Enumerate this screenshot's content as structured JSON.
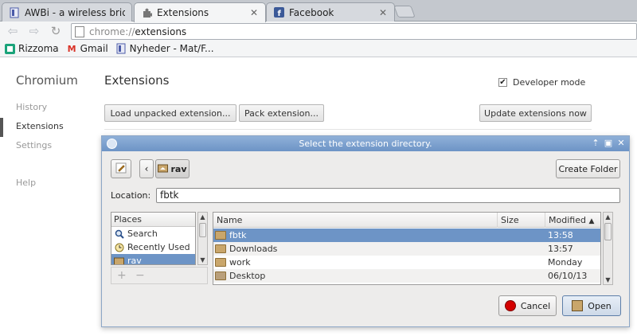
{
  "tabs": [
    {
      "title": "AWBi - a wireless bridge",
      "icon": "page-icon"
    },
    {
      "title": "Extensions",
      "icon": "puzzle-icon"
    },
    {
      "title": "Facebook",
      "icon": "facebook-icon"
    }
  ],
  "address": {
    "scheme": "chrome://",
    "path": "extensions"
  },
  "bookmarks": [
    {
      "label": "Rizzoma",
      "icon": "rizzoma-icon"
    },
    {
      "label": "Gmail",
      "icon": "gmail-icon"
    },
    {
      "label": "Nyheder - Mat/F...",
      "icon": "page-icon"
    }
  ],
  "sidebar": {
    "brand": "Chromium",
    "items": [
      {
        "label": "History"
      },
      {
        "label": "Extensions"
      },
      {
        "label": "Settings"
      },
      {
        "label": "Help"
      }
    ]
  },
  "page": {
    "title": "Extensions",
    "developer_mode": "Developer mode",
    "load_unpacked": "Load unpacked extension...",
    "pack": "Pack extension...",
    "update": "Update extensions now"
  },
  "dialog": {
    "title": "Select the extension directory.",
    "path_button": "rav",
    "create_folder": "Create Folder",
    "location_label": "Location:",
    "location_value": "fbtk",
    "places_header": "Places",
    "places": [
      {
        "label": "Search",
        "icon": "search-icon"
      },
      {
        "label": "Recently Used",
        "icon": "clock-icon"
      },
      {
        "label": "rav",
        "icon": "home-folder-icon"
      }
    ],
    "columns": {
      "name": "Name",
      "size": "Size",
      "modified": "Modified"
    },
    "files": [
      {
        "name": "fbtk",
        "modified": "13:58"
      },
      {
        "name": "Downloads",
        "modified": "13:57"
      },
      {
        "name": "work",
        "modified": "Monday"
      },
      {
        "name": "Desktop",
        "modified": "06/10/13"
      }
    ],
    "cancel": "Cancel",
    "open": "Open"
  },
  "colors": {
    "selection": "#6d94c6",
    "titlebar": "#7fa3d0"
  }
}
